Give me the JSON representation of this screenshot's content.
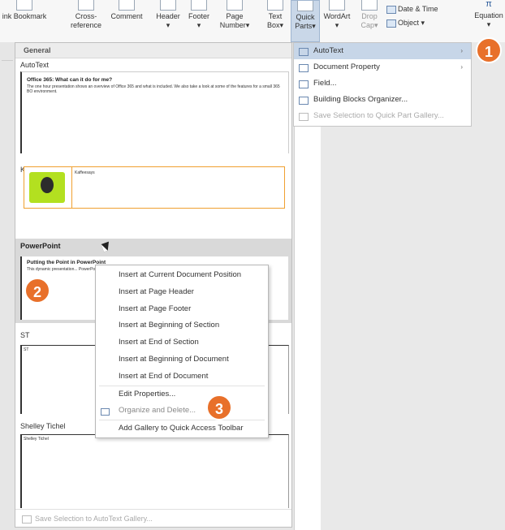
{
  "ribbon": {
    "items": [
      {
        "label": "ink Bookmark",
        "sub": ""
      },
      {
        "label": "Cross-",
        "sub": "reference"
      },
      {
        "label": "Comment",
        "sub": ""
      },
      {
        "label": "Header",
        "sub": "▾"
      },
      {
        "label": "Footer",
        "sub": "▾"
      },
      {
        "label": "Page",
        "sub": "Number▾"
      },
      {
        "label": "Text",
        "sub": "Box▾"
      },
      {
        "label": "Quick",
        "sub": "Parts▾"
      },
      {
        "label": "WordArt",
        "sub": "▾"
      },
      {
        "label": "Drop",
        "sub": "Cap▾"
      },
      {
        "label": "Equation",
        "sub": "▾"
      }
    ],
    "date_time": "Date & Time",
    "object": "Object ▾"
  },
  "gallery": {
    "header": "General",
    "categories": {
      "autotext": "AutoText",
      "kaffeesays": "Kaffeesays",
      "powerpoint": "PowerPoint",
      "st": "ST",
      "shelley": "Shelley Tichel"
    },
    "autotext_entry": {
      "title": "Office 365: What can it do for me?",
      "body": "The one hour presentation shows an overview of Office 365 and what is included. We also take a look at some of the features for a small 365 BO environment."
    },
    "kaffee_entry": {
      "name": "Kaffeesays"
    },
    "ppt_entry": {
      "title": "Putting the Point in PowerPoint",
      "body": "This dynamic presentation... PowerPoint... features and..."
    },
    "st_entry": {
      "text": "ST"
    },
    "shelley_entry": {
      "text": "Shelley Tichel"
    },
    "footer": "Save Selection to AutoText Gallery..."
  },
  "quick_parts_menu": {
    "items": [
      {
        "label": "AutoText",
        "arrow": "›"
      },
      {
        "label": "Document Property",
        "arrow": "›"
      },
      {
        "label": "Field...",
        "arrow": ""
      },
      {
        "label": "Building Blocks Organizer...",
        "arrow": ""
      },
      {
        "label": "Save Selection to Quick Part Gallery...",
        "arrow": ""
      }
    ]
  },
  "context_menu": {
    "items": [
      "Insert at Current Document Position",
      "Insert at Page Header",
      "Insert at Page Footer",
      "Insert at Beginning of Section",
      "Insert at End of Section",
      "Insert at Beginning of Document",
      "Insert at End of Document",
      "Edit Properties...",
      "Organize and Delete...",
      "Add Gallery to Quick Access Toolbar"
    ]
  },
  "badges": {
    "b1": "1",
    "b2": "2",
    "b3": "3"
  },
  "colors": {
    "badge": "#e8702a",
    "highlight": "#c7d6e8",
    "orange_border": "#f0a030"
  }
}
